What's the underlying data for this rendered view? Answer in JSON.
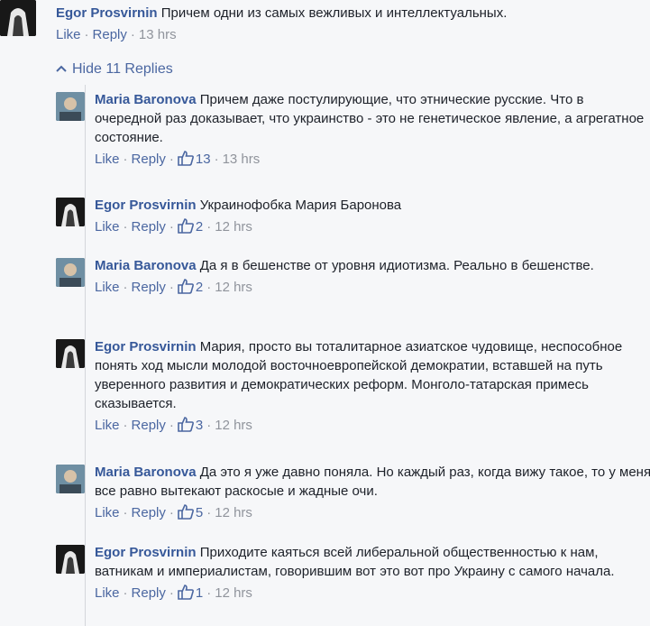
{
  "top": {
    "author": "Egor Prosvirnin",
    "text": "Причем одни из самых вежливых и интеллектуальных.",
    "like": "Like",
    "reply": "Reply",
    "time": "13 hrs"
  },
  "hide_replies": "Hide 11 Replies",
  "replies": [
    {
      "author": "Maria Baronova",
      "text": "Причем даже постулирующие, что этнические русские. Что в очередной раз доказывает, что украинство - это не генетическое явление, а агрегатное состояние.",
      "like": "Like",
      "reply": "Reply",
      "likes": "13",
      "time": "13 hrs"
    },
    {
      "author": "Egor Prosvirnin",
      "text": "Украинофобка Мария Баронова",
      "like": "Like",
      "reply": "Reply",
      "likes": "2",
      "time": "12 hrs"
    },
    {
      "author": "Maria Baronova",
      "text": "Да я в бешенстве от уровня идиотизма. Реально в бешенстве.",
      "like": "Like",
      "reply": "Reply",
      "likes": "2",
      "time": "12 hrs"
    },
    {
      "author": "Egor Prosvirnin",
      "text": "Мария, просто вы тоталитарное азиатское чудовище, неспособное понять ход мысли молодой восточноевропейской демократии, вставшей на путь уверенного развития и демократических реформ. Монголо-татарская примесь сказывается.",
      "like": "Like",
      "reply": "Reply",
      "likes": "3",
      "time": "12 hrs"
    },
    {
      "author": "Maria Baronova",
      "text": "Да это я уже давно поняла. Но каждый раз, когда вижу такое, то у меня все равно вытекают раскосые и жадные очи.",
      "like": "Like",
      "reply": "Reply",
      "likes": "5",
      "time": "12 hrs"
    },
    {
      "author": "Egor Prosvirnin",
      "text": "Приходите каяться всей либеральной общественностью к нам, ватникам и империалистам, говорившим вот это вот про Украину с самого начала.",
      "like": "Like",
      "reply": "Reply",
      "likes": "1",
      "time": "12 hrs"
    }
  ],
  "colors": {
    "link": "#4b67a1",
    "author": "#365899",
    "meta": "#90949c",
    "background": "#f6f7f9"
  }
}
